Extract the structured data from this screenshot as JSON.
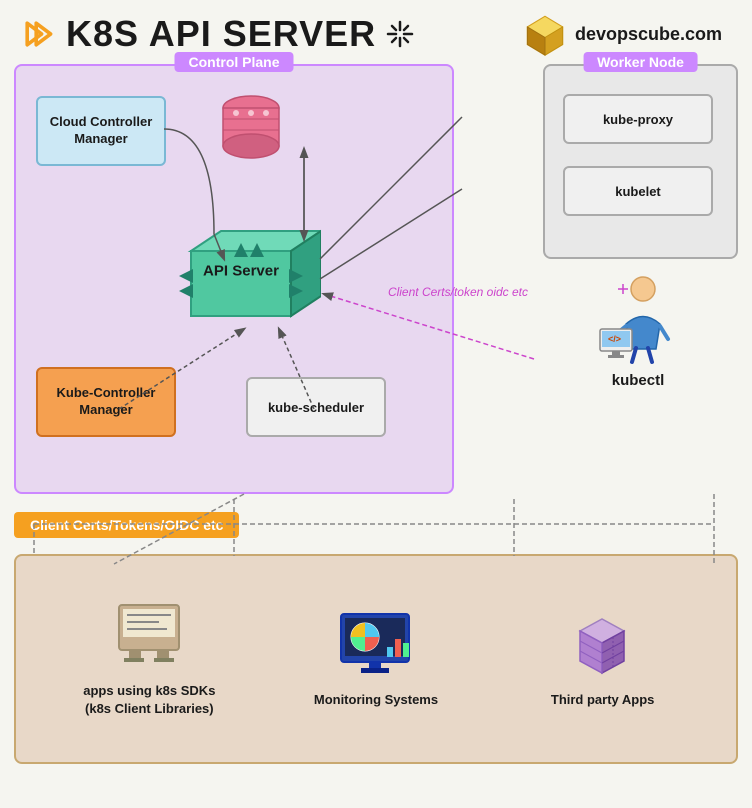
{
  "header": {
    "title": "K8s API Server",
    "brand": "devopscube.com",
    "sparks": "✦ ✦"
  },
  "control_plane": {
    "label": "Control Plane",
    "cloud_controller": "Cloud Controller\nManager",
    "kube_controller": "Kube-Controller\nManager",
    "kube_scheduler": "kube-scheduler",
    "api_server": "API Server"
  },
  "worker_node": {
    "label": "Worker Node",
    "kube_proxy": "kube-proxy",
    "kubelet": "kubelet"
  },
  "kubectl": {
    "label": "kubectl"
  },
  "client_certs_inner": "Client Certs/token\noidc etc",
  "client_certs_banner": "Client Certs/Tokens/OIDC etc",
  "bottom_items": [
    {
      "label": "apps using k8s SDKs\n(k8s Client Libraries)",
      "icon": "sdk"
    },
    {
      "label": "Monitoring Systems",
      "icon": "monitoring"
    },
    {
      "label": "Third party Apps",
      "icon": "thirdparty"
    }
  ]
}
